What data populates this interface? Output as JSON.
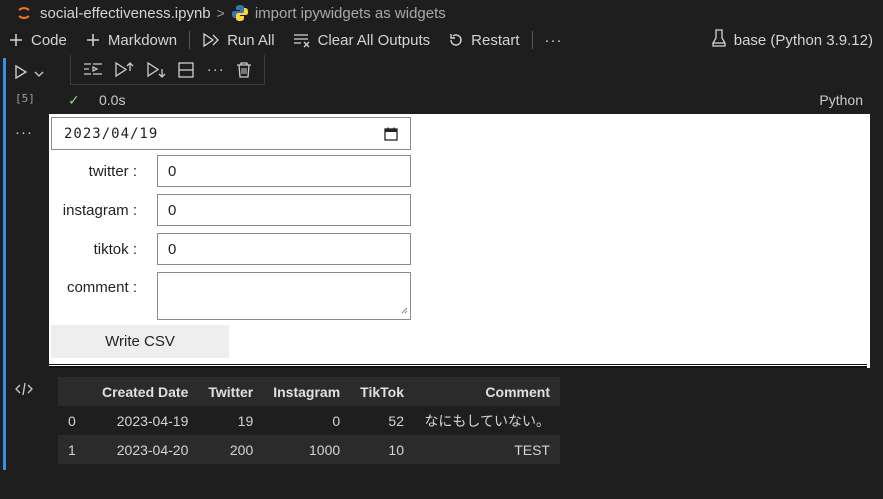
{
  "breadcrumb": {
    "file": "social-effectiveness.ipynb",
    "separator": ">",
    "symbol": "import ipywidgets as widgets"
  },
  "toolbar": {
    "code_label": "Code",
    "markdown_label": "Markdown",
    "run_all_label": "Run All",
    "clear_label": "Clear All Outputs",
    "restart_label": "Restart",
    "more_label": "···",
    "kernel_label": "base (Python 3.9.12)"
  },
  "cell": {
    "exec_count": "[5]",
    "check": "✓",
    "time": "0.0s",
    "language": "Python"
  },
  "widgets": {
    "date_value": "2023/04/19",
    "fields": [
      {
        "label": "twitter :",
        "value": "0"
      },
      {
        "label": "instagram :",
        "value": "0"
      },
      {
        "label": "tiktok :",
        "value": "0"
      }
    ],
    "comment_label": "comment :",
    "comment_value": "",
    "button_label": "Write CSV"
  },
  "output_more": "···",
  "table": {
    "headers": [
      "",
      "Created Date",
      "Twitter",
      "Instagram",
      "TikTok",
      "Comment"
    ],
    "rows": [
      [
        "0",
        "2023-04-19",
        "19",
        "0",
        "52",
        "なにもしていない。"
      ],
      [
        "1",
        "2023-04-20",
        "200",
        "1000",
        "10",
        "TEST"
      ]
    ]
  },
  "colors": {
    "background": "#1e1e1e",
    "cell_border_active": "#3a8ee6",
    "success": "#89d185"
  },
  "icons": [
    "jupyter-icon",
    "python-icon",
    "plus-icon",
    "run-all-icon",
    "clear-outputs-icon",
    "restart-icon",
    "kernel-icon",
    "run-cell-icon",
    "chevron-down-icon",
    "run-by-line-icon",
    "execute-above-icon",
    "execute-below-icon",
    "split-cell-icon",
    "more-icon",
    "trash-icon",
    "calendar-icon",
    "code-output-icon"
  ]
}
